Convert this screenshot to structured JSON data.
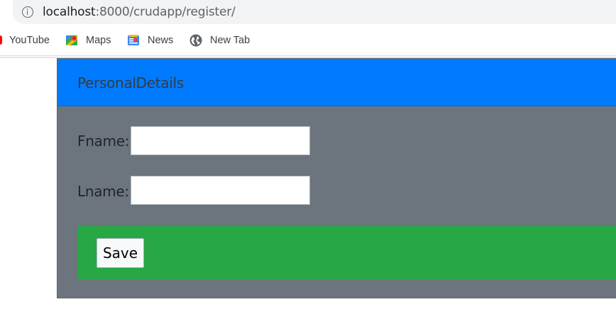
{
  "browser": {
    "url_host": "localhost",
    "url_rest": ":8000/crudapp/register/",
    "bookmarks": [
      {
        "label": "YouTube",
        "icon": "youtube-icon"
      },
      {
        "label": "Maps",
        "icon": "maps-icon"
      },
      {
        "label": "News",
        "icon": "news-icon"
      },
      {
        "label": "New Tab",
        "icon": "globe-icon"
      }
    ]
  },
  "card": {
    "title": "PersonalDetails",
    "fields": [
      {
        "label": "Fname:",
        "value": ""
      },
      {
        "label": "Lname:",
        "value": ""
      }
    ],
    "save_label": "Save"
  },
  "colors": {
    "header": "#007bff",
    "card_body": "#6c757d",
    "footer": "#28a745"
  }
}
